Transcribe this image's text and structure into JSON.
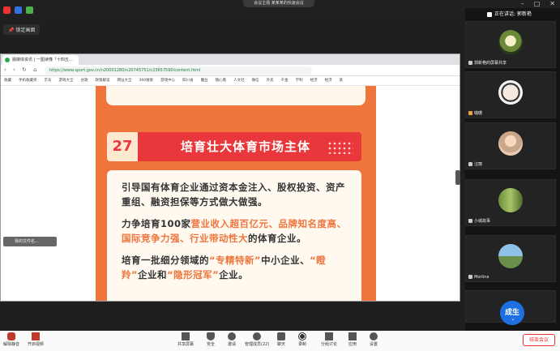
{
  "meeting": {
    "pill_text": "会议主题 某某某的快速会议",
    "view_label": "锁定画面",
    "speaking_label": "正在讲话: 郭新艳"
  },
  "browser": {
    "tab_title": "融媒体资讯 | 一图读懂「十四五…",
    "url": "https://www.sport.gov.cn/n20001280/n20745751/c23657590/content.html",
    "bookmarks": [
      "收藏",
      "手机收藏夹",
      "京东",
      "游戏大全",
      "谷歌",
      "政策解读",
      "网址大全",
      "360搜索",
      "游戏中心",
      "四川省",
      "魔豆",
      "随心看",
      "人文社",
      "微信",
      "外卖",
      "千金",
      "学利",
      "经济",
      "经济",
      "某"
    ]
  },
  "slide": {
    "number": "27",
    "title": "培育壮大体育市场主体",
    "para1": "引导国有体育企业通过资本金注入、股权投资、资产重组、融资担保等方式做大做强。",
    "para2_a": "力争培育100家",
    "para2_hl1": "营业收入超百亿元、品牌知名度高、国际竞争力强、行业带动性大",
    "para2_b": "的体育企业。",
    "para3_a": "培育一批细分领域的",
    "para3_hl1": "“专精特新”",
    "para3_b": "中小企业、",
    "para3_hl2": "“瞪羚”",
    "para3_c": "企业和",
    "para3_hl3": "“隐形冠军”",
    "para3_d": "企业。",
    "thumb_label": "我的文件名..."
  },
  "participants": [
    {
      "name": "郭新艳的屏幕共享",
      "avatar": "flower"
    },
    {
      "name": "璐珊",
      "avatar": "cartoon"
    },
    {
      "name": "汪丽",
      "avatar": "girl"
    },
    {
      "name": "小城故事",
      "avatar": "plant"
    },
    {
      "name": "Morlina",
      "avatar": "landscape"
    },
    {
      "name": "",
      "avatar": "成生"
    }
  ],
  "toolbar": {
    "mic": "解除静音",
    "video": "开启视频",
    "share": "共享屏幕",
    "security": "安全",
    "invite": "邀请",
    "members": "管理成员(22)",
    "chat": "聊天",
    "record": "录制",
    "breakout": "分组讨论",
    "apps": "应用",
    "settings": "设置",
    "end": "结束会议"
  },
  "colors": {
    "accent": "#f0753d",
    "header_red": "#e8383c",
    "meeting_blue": "#1e6fe0"
  }
}
